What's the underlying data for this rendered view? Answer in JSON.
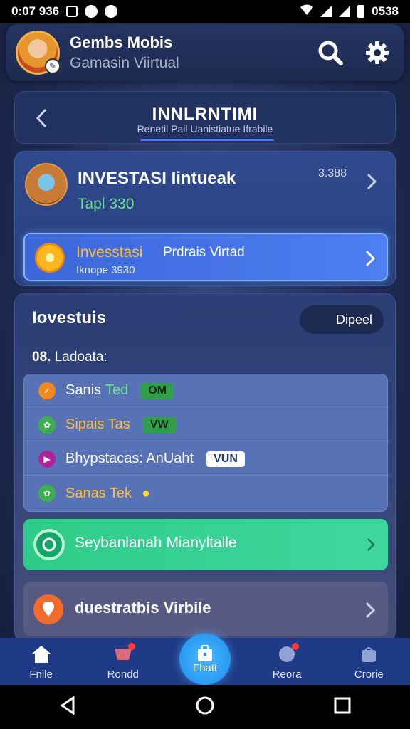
{
  "status_bar": {
    "time_left": "0:07 936",
    "time_right": "0538"
  },
  "header": {
    "title": "Gembs Mobis",
    "subtitle": "Gamasin Viirtual"
  },
  "nav": {
    "title": "INNLRNTIMI",
    "subtitle": "Renetil Pail Uanistiatue Ifrabile"
  },
  "investment": {
    "title": "INVESTASI Iintueak",
    "amount": "Tapl 330",
    "value": "3.388",
    "product": {
      "label_a": "Invesstasi",
      "label_b": "Prdrais Virtad",
      "sub": "Iknope 3930"
    }
  },
  "list": {
    "title": "Iovestuis",
    "button": "Dipeel",
    "section_number": "08.",
    "section_label": "Ladoata:",
    "items": [
      {
        "text": "Sanis",
        "text2": "Ted",
        "tag": "OM",
        "dot_color": "#f08a1e"
      },
      {
        "text": "Sipais Tas",
        "text2": "",
        "tag": "VW",
        "dot_color": "#3db04e"
      },
      {
        "text": "Bhypstacas: AnUaht",
        "text2": "",
        "tag": "VUN",
        "dot_color": "#b0229a"
      },
      {
        "text": "Sanas Tek",
        "text2": "",
        "tag": "",
        "dot_color": "#3db04e"
      }
    ],
    "green_row": "Seybanlanah Mianyltalle",
    "orange_row": "duestratbis Virbile"
  },
  "bottom_nav": {
    "items": [
      "Fnile",
      "Rondd",
      "Fhatt",
      "Reora",
      "Crorie"
    ]
  },
  "colors": {
    "accent": "#4f7cff",
    "green": "#2ecc88",
    "orange": "#f16b2a",
    "gold": "#ffbf3a"
  }
}
